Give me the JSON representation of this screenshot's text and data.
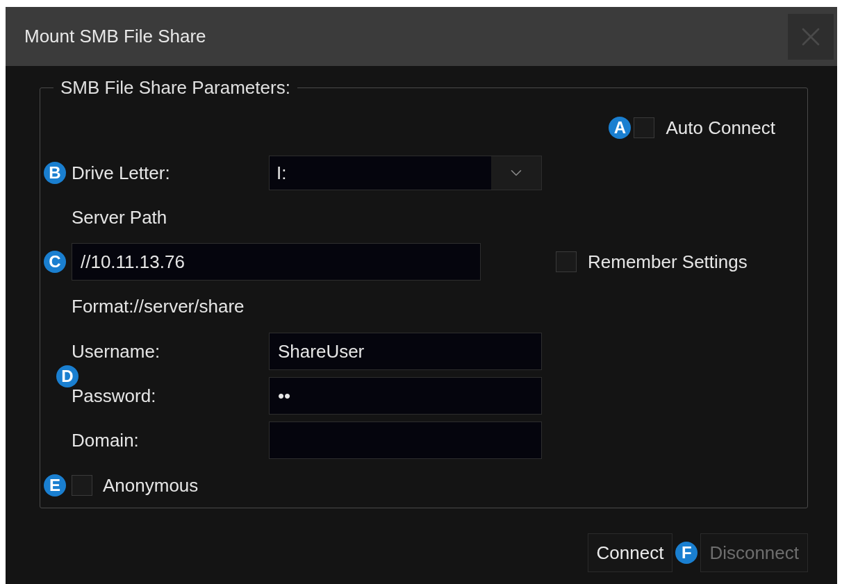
{
  "window": {
    "title": "Mount SMB File Share"
  },
  "group": {
    "title": "SMB File Share Parameters:"
  },
  "auto_connect": {
    "callout": "A",
    "label": "Auto Connect",
    "checked": false
  },
  "drive_letter": {
    "callout": "B",
    "label": "Drive Letter:",
    "value": "I:"
  },
  "server_path": {
    "label": "Server Path",
    "callout": "C",
    "value": "//10.11.13.76",
    "hint": "Format://server/share"
  },
  "remember_settings": {
    "label": "Remember Settings",
    "checked": false
  },
  "credentials": {
    "callout": "D",
    "fields": [
      {
        "label": "Username:",
        "value": "ShareUser"
      },
      {
        "label": "Password:",
        "value": "••"
      },
      {
        "label": "Domain:"
      }
    ]
  },
  "anonymous": {
    "callout": "E",
    "label": "Anonymous",
    "checked": false
  },
  "buttons": [
    {
      "label": "Connect",
      "disabled": false
    },
    {
      "callout": "F",
      "label": "Disconnect",
      "disabled": true
    }
  ]
}
